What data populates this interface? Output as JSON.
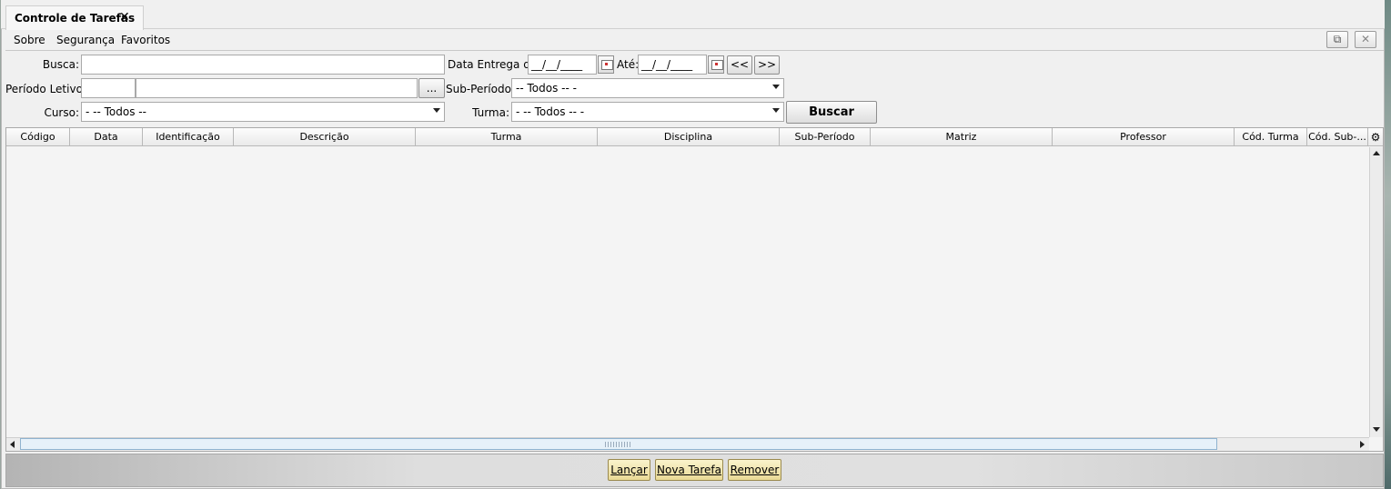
{
  "tab": {
    "title": "Controle de Tarefas",
    "close": "✕"
  },
  "menu": {
    "items": [
      "Sobre",
      "Segurança",
      "Favoritos"
    ]
  },
  "window_buttons": {
    "popout": "⧉",
    "close": "✕"
  },
  "filters": {
    "busca_label": "Busca:",
    "busca_value": "",
    "data_entrega_label": "Data Entrega de:",
    "data_de_value": "__/__/____",
    "ate_label": "Até:",
    "data_ate_value": "__/__/____",
    "prev_label": "<<",
    "next_label": ">>",
    "periodo_label": "Período Letivo:",
    "periodo_code_value": "",
    "periodo_desc_value": "",
    "periodo_browse_label": "...",
    "subperiodo_label": "Sub-Período:",
    "subperiodo_value": "-- Todos -- -",
    "curso_label": "Curso:",
    "curso_value": "- -- Todos --",
    "turma_label": "Turma:",
    "turma_value": "- -- Todos -- -",
    "buscar_label": "Buscar"
  },
  "table": {
    "columns": [
      "Código",
      "Data",
      "Identificação",
      "Descrição",
      "Turma",
      "Disciplina",
      "Sub-Período",
      "Matriz",
      "Professor",
      "Cód. Turma",
      "Cód. Sub-..."
    ],
    "rows": []
  },
  "footer": {
    "lancar": "Lançar",
    "nova_tarefa": "Nova Tarefa",
    "remover": "Remover"
  },
  "icons": {
    "tab_close": "close-icon",
    "gear": "gear-icon",
    "calendar": "calendar-icon",
    "scroll_up": "arrow-up-icon",
    "scroll_down": "arrow-down-icon",
    "scroll_left": "arrow-left-icon",
    "scroll_right": "arrow-right-icon"
  }
}
